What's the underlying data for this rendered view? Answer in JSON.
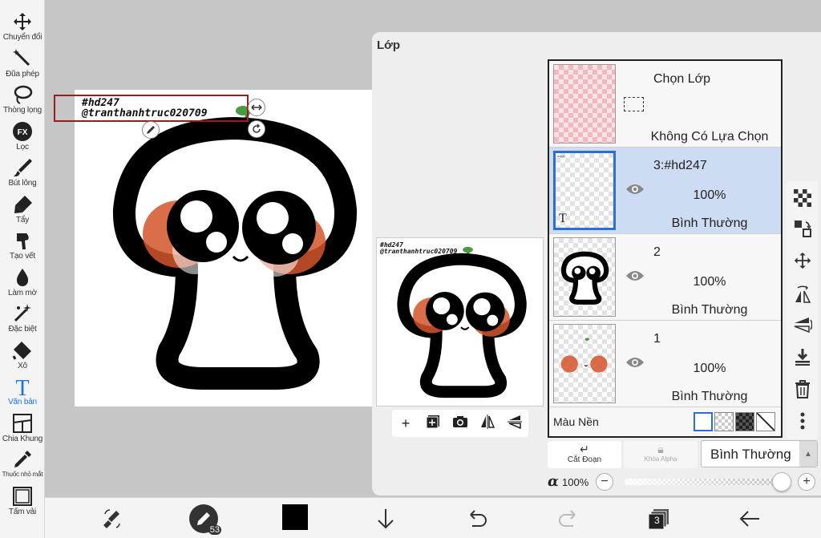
{
  "toolbar": {
    "tools": [
      {
        "label": "Chuyển đổi",
        "icon": "move-icon"
      },
      {
        "label": "Đũa phép",
        "icon": "magic-wand-icon"
      },
      {
        "label": "Thòng lọng",
        "icon": "lasso-icon"
      },
      {
        "label": "Lọc",
        "icon": "filter-fx-icon"
      },
      {
        "label": "Bút lông",
        "icon": "brush-icon"
      },
      {
        "label": "Tẩy",
        "icon": "eraser-icon"
      },
      {
        "label": "Tạo vết",
        "icon": "smudge-icon"
      },
      {
        "label": "Làm mờ",
        "icon": "blur-drop-icon"
      },
      {
        "label": "Đặc biệt",
        "icon": "special-sparkle-icon"
      },
      {
        "label": "Xô",
        "icon": "bucket-icon"
      },
      {
        "label": "Văn bản",
        "icon": "text-icon"
      },
      {
        "label": "Chia Khung",
        "icon": "frame-divider-icon"
      },
      {
        "label": "Thuốc nhỏ mắt",
        "icon": "eyedropper-icon"
      },
      {
        "label": "Tấm vải",
        "icon": "canvas-icon"
      }
    ],
    "active_tool": "Văn bản",
    "accent_color": "#1a73e8"
  },
  "canvas": {
    "text_line_1": "#hd247",
    "text_line_2": "@tranthanhtruc020709",
    "selection_color": "#9a1c1c"
  },
  "layer_panel": {
    "title": "Lớp",
    "selection_layer": {
      "name": "Chọn Lớp",
      "status": "Không Có Lựa Chọn"
    },
    "layers": [
      {
        "name": "3:#hd247",
        "opacity": "100%",
        "blend": "Bình Thường",
        "selected": true
      },
      {
        "name": "2",
        "opacity": "100%",
        "blend": "Bình Thường",
        "selected": false
      },
      {
        "name": "1",
        "opacity": "100%",
        "blend": "Bình Thường",
        "selected": false
      }
    ],
    "background_label": "Màu Nền",
    "preview_text_1": "#hd247",
    "preview_text_2": "@tranthanhtruc020709",
    "clip_label": "Cắt Đoạn",
    "alpha_lock_label": "Khóa Alpha",
    "blend_mode": "Bình Thường",
    "alpha_symbol": "α",
    "alpha_value": "100%",
    "selected_color": "#cddcf2"
  },
  "bottom_bar": {
    "brush_size": "53",
    "layer_count": "3",
    "color": "#000000"
  }
}
